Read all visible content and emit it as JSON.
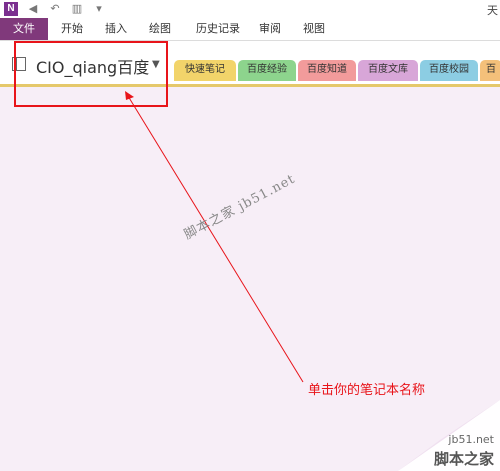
{
  "qat": {
    "logo": "N",
    "back_icon": "back-icon",
    "undo_icon": "undo-icon",
    "layout_icon": "layout-icon",
    "more_icon": "customize-icon",
    "title_fragment": "天"
  },
  "ribbon": {
    "file": "文件",
    "tabs": [
      "开始",
      "插入",
      "绘图",
      "历史记录",
      "审阅",
      "视图"
    ]
  },
  "notebook": {
    "name": "CIO_qiang百度"
  },
  "sections": [
    {
      "label": "快速笔记",
      "color": "#f2d46a"
    },
    {
      "label": "百度经验",
      "color": "#8dd48d"
    },
    {
      "label": "百度知道",
      "color": "#f29b9b"
    },
    {
      "label": "百度文库",
      "color": "#d8a6d8"
    },
    {
      "label": "百度校园",
      "color": "#8ccde3"
    },
    {
      "label": "百",
      "color": "#f4c07a"
    }
  ],
  "overlay": {
    "watermark": "脚本之家 jb51.net",
    "annotation": "单击你的笔记本名称",
    "corner_site": "jb51.net",
    "corner_brand": "脚本之家"
  },
  "colors": {
    "accent": "#80397b",
    "annotation": "#e8141a"
  }
}
